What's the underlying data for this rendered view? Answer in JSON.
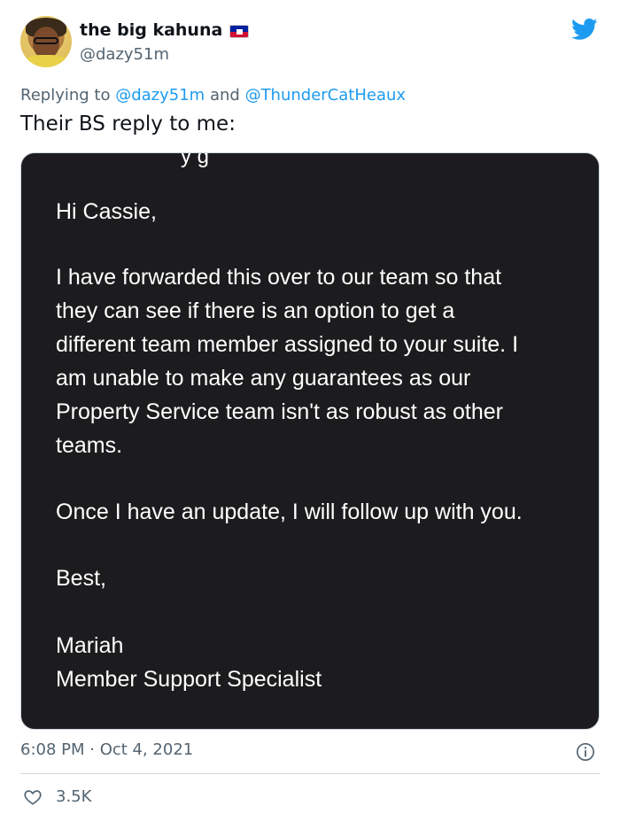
{
  "user": {
    "display_name": "the big kahuna",
    "handle": "@dazy51m"
  },
  "reply": {
    "prefix": "Replying to",
    "mention1": "@dazy51m",
    "joiner": "and",
    "mention2": "@ThunderCatHeaux"
  },
  "tweet": {
    "text": "Their BS reply to me:"
  },
  "email": {
    "cut_top_text": "y g",
    "lines": [
      "Hi Cassie,",
      "I have forwarded this over to our team so that",
      "they can see if there is an option to get a",
      "different team member assigned to your suite. I",
      "am unable to make any guarantees as our",
      "Property Service team isn't as robust as other",
      "teams.",
      "Once I have an update, I will follow up with you.",
      "Best,",
      "Mariah",
      "Member Support Specialist"
    ]
  },
  "meta": {
    "timestamp": "6:08 PM · Oct 4, 2021",
    "likes": "3.5K"
  },
  "colors": {
    "accent": "#1d9bf0",
    "muted": "#536471",
    "media_bg": "#1c1c1e"
  },
  "icons": {
    "bird": "twitter-bird-icon",
    "flag": "haiti-flag-icon",
    "info": "info-icon",
    "heart": "heart-icon"
  }
}
